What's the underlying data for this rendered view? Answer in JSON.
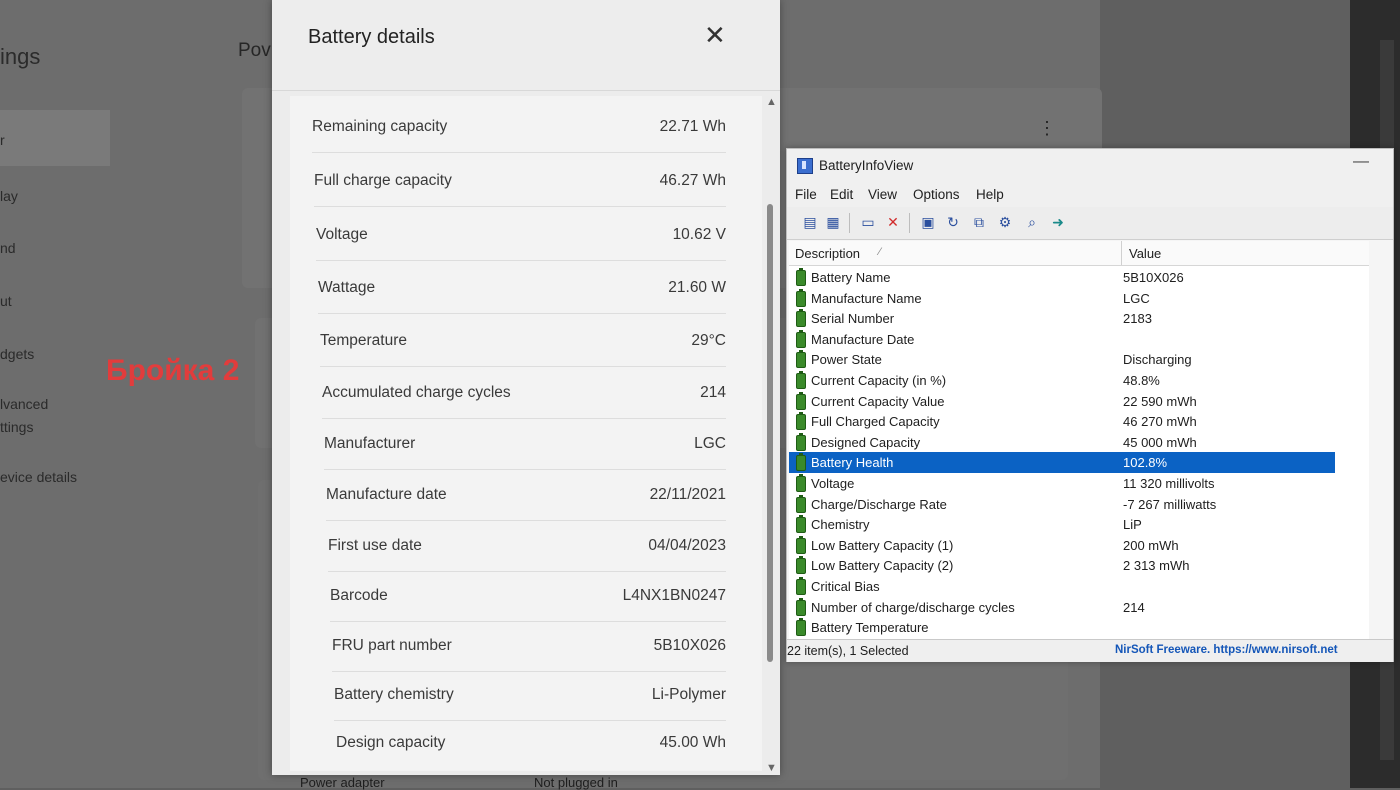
{
  "background": {
    "title_fragment": "ings",
    "nav_items": [
      "r",
      "lay",
      "nd",
      "ut",
      "dgets",
      "lvanced",
      "ttings",
      "evice details"
    ],
    "section_fragment": "Pov",
    "power_adapter_label": "Power adapter",
    "power_adapter_value": "Not plugged in",
    "more_icon": "kebab-icon",
    "annotation": "Бройка 2"
  },
  "battery_details": {
    "title": "Battery details",
    "close_icon": "close-icon",
    "rows": [
      {
        "label": "Remaining capacity",
        "value": "22.71 Wh"
      },
      {
        "label": "Full charge capacity",
        "value": "46.27 Wh"
      },
      {
        "label": "Voltage",
        "value": "10.62 V"
      },
      {
        "label": "Wattage",
        "value": "21.60 W"
      },
      {
        "label": "Temperature",
        "value": "29°C"
      },
      {
        "label": "Accumulated charge cycles",
        "value": "214"
      },
      {
        "label": "Manufacturer",
        "value": "LGC"
      },
      {
        "label": "Manufacture date",
        "value": "22/11/2021"
      },
      {
        "label": "First use date",
        "value": "04/04/2023"
      },
      {
        "label": "Barcode",
        "value": "L4NX1BN0247"
      },
      {
        "label": "FRU part number",
        "value": "5B10X026"
      },
      {
        "label": "Battery chemistry",
        "value": "Li-Polymer"
      },
      {
        "label": "Design capacity",
        "value": "45.00 Wh"
      }
    ]
  },
  "batteryinfoview": {
    "title": "BatteryInfoView",
    "menu": [
      "File",
      "Edit",
      "View",
      "Options",
      "Help"
    ],
    "toolbar_icons": [
      "properties-icon",
      "copy-icon",
      "html-report-icon",
      "delete-icon",
      "save-icon",
      "refresh-icon",
      "copy-selected-icon",
      "options-icon",
      "find-icon",
      "exit-icon"
    ],
    "columns": {
      "description": "Description",
      "value": "Value"
    },
    "rows": [
      {
        "description": "Battery Name",
        "value": "5B10X026"
      },
      {
        "description": "Manufacture Name",
        "value": "LGC"
      },
      {
        "description": "Serial Number",
        "value": "2183"
      },
      {
        "description": "Manufacture Date",
        "value": ""
      },
      {
        "description": "Power State",
        "value": "Discharging"
      },
      {
        "description": "Current Capacity (in %)",
        "value": "48.8%"
      },
      {
        "description": "Current Capacity Value",
        "value": "22 590 mWh"
      },
      {
        "description": "Full Charged Capacity",
        "value": "46 270 mWh"
      },
      {
        "description": "Designed Capacity",
        "value": "45 000 mWh"
      },
      {
        "description": "Battery Health",
        "value": "102.8%",
        "selected": true
      },
      {
        "description": "Voltage",
        "value": "11 320 millivolts"
      },
      {
        "description": "Charge/Discharge Rate",
        "value": "-7 267 milliwatts"
      },
      {
        "description": "Chemistry",
        "value": "LiP"
      },
      {
        "description": "Low Battery Capacity (1)",
        "value": "200 mWh"
      },
      {
        "description": "Low Battery Capacity (2)",
        "value": "2 313 mWh"
      },
      {
        "description": "Critical Bias",
        "value": ""
      },
      {
        "description": "Number of charge/discharge cycles",
        "value": "214"
      },
      {
        "description": "Battery Temperature",
        "value": ""
      }
    ],
    "status_left": "22 item(s), 1 Selected",
    "status_right": "NirSoft Freeware. https://www.nirsoft.net",
    "selected_color": "#0b62c4"
  }
}
